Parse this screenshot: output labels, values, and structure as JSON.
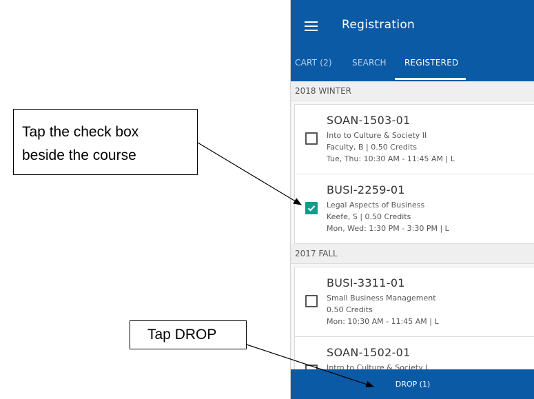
{
  "app": {
    "title": "Registration",
    "menu_icon": "hamburger-menu-icon"
  },
  "tabs": [
    {
      "label": "CART (2)",
      "active": false
    },
    {
      "label": "SEARCH",
      "active": false
    },
    {
      "label": "REGISTERED",
      "active": true
    }
  ],
  "terms": [
    {
      "name": "2018 WINTER",
      "courses": [
        {
          "code": "SOAN-1503-01",
          "title": "Into to Culture & Society II",
          "instructor": "Faculty, B | 0.50 Credits",
          "schedule": "Tue, Thu: 10:30 AM - 11:45 AM | L",
          "checked": false
        },
        {
          "code": "BUSI-2259-01",
          "title": "Legal Aspects of Business",
          "instructor": "Keefe, S | 0.50 Credits",
          "schedule": "Mon, Wed: 1:30 PM - 3:30 PM | L",
          "checked": true
        }
      ]
    },
    {
      "name": "2017 FALL",
      "courses": [
        {
          "code": "BUSI-3311-01",
          "title": "Small Business Management",
          "instructor": "0.50 Credits",
          "schedule": "Mon: 10:30 AM - 11:45 AM | L",
          "checked": false
        },
        {
          "code": "SOAN-1502-01",
          "title": "Intro to Culture & Society I",
          "instructor": "",
          "schedule": "",
          "checked": false
        }
      ]
    }
  ],
  "drop_button": {
    "label": "DROP (1)"
  },
  "callouts": {
    "checkbox_line1": "Tap the check box",
    "checkbox_line2": "beside the course",
    "drop": "Tap DROP"
  },
  "colors": {
    "primary": "#0b5aa5",
    "check": "#149b8a"
  }
}
